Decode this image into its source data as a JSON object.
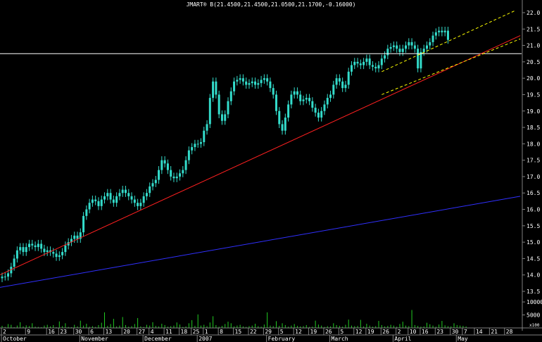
{
  "chart_data": {
    "type": "candlestick",
    "title": "JMART® B(21.4500,21.4500,21.0500,21.1700,-0.16000)",
    "price_axis": {
      "ylim": [
        13.2,
        22.3
      ],
      "ticks": [
        "22.0",
        "21.5",
        "21.0",
        "20.5",
        "20.0",
        "19.5",
        "19.0",
        "18.5",
        "18.0",
        "17.5",
        "17.0",
        "16.5",
        "16.0",
        "15.5",
        "15.0",
        "14.5",
        "14.0",
        "13.5"
      ],
      "tick_values": [
        22.0,
        21.5,
        21.0,
        20.5,
        20.0,
        19.5,
        19.0,
        18.5,
        18.0,
        17.5,
        17.0,
        16.5,
        16.0,
        15.5,
        15.0,
        14.5,
        14.0,
        13.5
      ]
    },
    "volume_axis": {
      "ylim": [
        0,
        13000
      ],
      "ticks": [
        "10000",
        "5000"
      ],
      "tick_values": [
        10000,
        5000
      ],
      "unit_label": "x100"
    },
    "x_axis": {
      "n_bars": 160,
      "date_ticks": [
        {
          "label": "2",
          "bar": 0
        },
        {
          "label": "9",
          "bar": 8
        },
        {
          "label": "16",
          "bar": 15
        },
        {
          "label": "23",
          "bar": 19
        },
        {
          "label": "30",
          "bar": 24
        },
        {
          "label": "6",
          "bar": 29
        },
        {
          "label": "13",
          "bar": 34
        },
        {
          "label": "20",
          "bar": 40
        },
        {
          "label": "27",
          "bar": 45
        },
        {
          "label": "4",
          "bar": 49
        },
        {
          "label": "11",
          "bar": 54
        },
        {
          "label": "18",
          "bar": 59
        },
        {
          "label": "25",
          "bar": 63
        },
        {
          "label": "1",
          "bar": 67
        },
        {
          "label": "8",
          "bar": 72
        },
        {
          "label": "15",
          "bar": 77
        },
        {
          "label": "22",
          "bar": 82
        },
        {
          "label": "29",
          "bar": 87
        },
        {
          "label": "5",
          "bar": 92
        },
        {
          "label": "12",
          "bar": 97
        },
        {
          "label": "19",
          "bar": 102
        },
        {
          "label": "26",
          "bar": 107
        },
        {
          "label": "5",
          "bar": 112
        },
        {
          "label": "12",
          "bar": 117
        },
        {
          "label": "19",
          "bar": 121
        },
        {
          "label": "26",
          "bar": 126
        },
        {
          "label": "2",
          "bar": 131
        },
        {
          "label": "10",
          "bar": 135
        },
        {
          "label": "16",
          "bar": 139
        },
        {
          "label": "23",
          "bar": 144
        },
        {
          "label": "30",
          "bar": 149
        },
        {
          "label": "7",
          "bar": 153
        },
        {
          "label": "14",
          "bar": 157
        },
        {
          "label": "21",
          "bar": 162
        },
        {
          "label": "28",
          "bar": 167
        }
      ],
      "month_ticks": [
        {
          "label": "October",
          "bar": 0
        },
        {
          "label": "November",
          "bar": 26
        },
        {
          "label": "December",
          "bar": 47
        },
        {
          "label": "2007",
          "bar": 65
        },
        {
          "label": "February",
          "bar": 88
        },
        {
          "label": "March",
          "bar": 109
        },
        {
          "label": "April",
          "bar": 130
        },
        {
          "label": "May",
          "bar": 151
        }
      ]
    },
    "closes": [
      13.95,
      13.95,
      14.05,
      14.25,
      14.5,
      14.75,
      14.85,
      14.7,
      14.85,
      14.95,
      14.9,
      14.85,
      14.95,
      14.8,
      14.7,
      14.75,
      14.7,
      14.65,
      14.55,
      14.6,
      14.7,
      14.9,
      15.0,
      15.1,
      15.2,
      15.1,
      15.3,
      15.8,
      16.0,
      16.2,
      16.3,
      16.25,
      16.1,
      16.3,
      16.4,
      16.5,
      16.3,
      16.2,
      16.4,
      16.5,
      16.6,
      16.5,
      16.4,
      16.3,
      16.2,
      16.1,
      16.2,
      16.4,
      16.5,
      16.7,
      16.8,
      16.9,
      17.2,
      17.5,
      17.4,
      17.2,
      17.0,
      16.95,
      17.0,
      17.1,
      17.2,
      17.5,
      17.8,
      17.9,
      18.0,
      18.0,
      18.05,
      18.4,
      18.6,
      19.4,
      19.9,
      19.5,
      18.9,
      18.7,
      18.9,
      19.3,
      19.6,
      19.9,
      19.95,
      20.0,
      19.9,
      19.8,
      19.85,
      19.9,
      19.8,
      19.85,
      19.95,
      20.0,
      19.9,
      19.7,
      19.5,
      19.0,
      18.6,
      18.4,
      18.8,
      19.2,
      19.5,
      19.6,
      19.5,
      19.3,
      19.35,
      19.4,
      19.3,
      19.1,
      18.95,
      18.8,
      19.0,
      19.2,
      19.4,
      19.5,
      19.8,
      20.0,
      19.9,
      19.7,
      19.8,
      20.2,
      20.4,
      20.5,
      20.45,
      20.4,
      20.5,
      20.6,
      20.4,
      20.35,
      20.3,
      20.4,
      20.6,
      20.7,
      20.9,
      20.95,
      21.0,
      20.9,
      20.8,
      20.9,
      21.0,
      21.1,
      21.0,
      20.9,
      20.3,
      20.8,
      20.9,
      21.0,
      21.1,
      21.3,
      21.4,
      21.45,
      21.4,
      21.45,
      21.17
    ],
    "volumes": [
      800,
      400,
      1500,
      1200,
      300,
      900,
      2200,
      600,
      1000,
      700,
      1800,
      500,
      400,
      300,
      900,
      1200,
      600,
      1100,
      300,
      2500,
      700,
      1800,
      400,
      300,
      1200,
      600,
      2800,
      900,
      1600,
      500,
      700,
      400,
      1100,
      2000,
      6000,
      800,
      1500,
      3500,
      600,
      900,
      4200,
      1100,
      500,
      700,
      1500,
      3800,
      600,
      400,
      1200,
      900,
      2200,
      800,
      600,
      1600,
      1100,
      500,
      700,
      900,
      2100,
      1300,
      400,
      600,
      1800,
      3000,
      800,
      5200,
      900,
      1200,
      700,
      2100,
      4500,
      1100,
      500,
      800,
      1500,
      2400,
      1800,
      600,
      900,
      1200,
      600,
      400,
      700,
      900,
      1600,
      700,
      500,
      1300,
      6000,
      900,
      700,
      2600,
      800,
      1800,
      1100,
      500,
      900,
      1500,
      800,
      600,
      700,
      1100,
      400,
      500,
      2800,
      1300,
      900,
      400,
      700,
      600,
      1800,
      1100,
      800,
      500,
      1200,
      3200,
      900,
      700,
      800,
      3100,
      600,
      1600,
      900,
      500,
      700,
      2700,
      1100,
      600,
      800,
      1200,
      900,
      500,
      1500,
      2400,
      900,
      700,
      6900,
      1100,
      800,
      500,
      600,
      2000,
      1400,
      900,
      500,
      1300,
      2700,
      1000,
      700,
      600,
      1800,
      1100,
      900,
      800,
      600
    ],
    "trendlines": [
      {
        "color": "#ff2020",
        "from": {
          "bar": -2,
          "price": 13.95
        },
        "to": {
          "bar": 172,
          "price": 21.3
        }
      },
      {
        "color": "#3030ff",
        "from": {
          "bar": -2,
          "price": 13.6
        },
        "to": {
          "bar": 172,
          "price": 16.4
        }
      },
      {
        "color": "#ffff00",
        "dashed": true,
        "from": {
          "bar": 126,
          "price": 20.2
        },
        "to": {
          "bar": 170,
          "price": 22.05
        }
      },
      {
        "color": "#ffff00",
        "dashed": true,
        "from": {
          "bar": 126,
          "price": 19.5
        },
        "to": {
          "bar": 172,
          "price": 21.2
        }
      }
    ],
    "reference_line": {
      "color": "#ffffff",
      "price": 20.75
    },
    "colors": {
      "candle": "#33dccb",
      "volume": "#22cc22",
      "background": "#000000",
      "axis": "#808080"
    }
  }
}
